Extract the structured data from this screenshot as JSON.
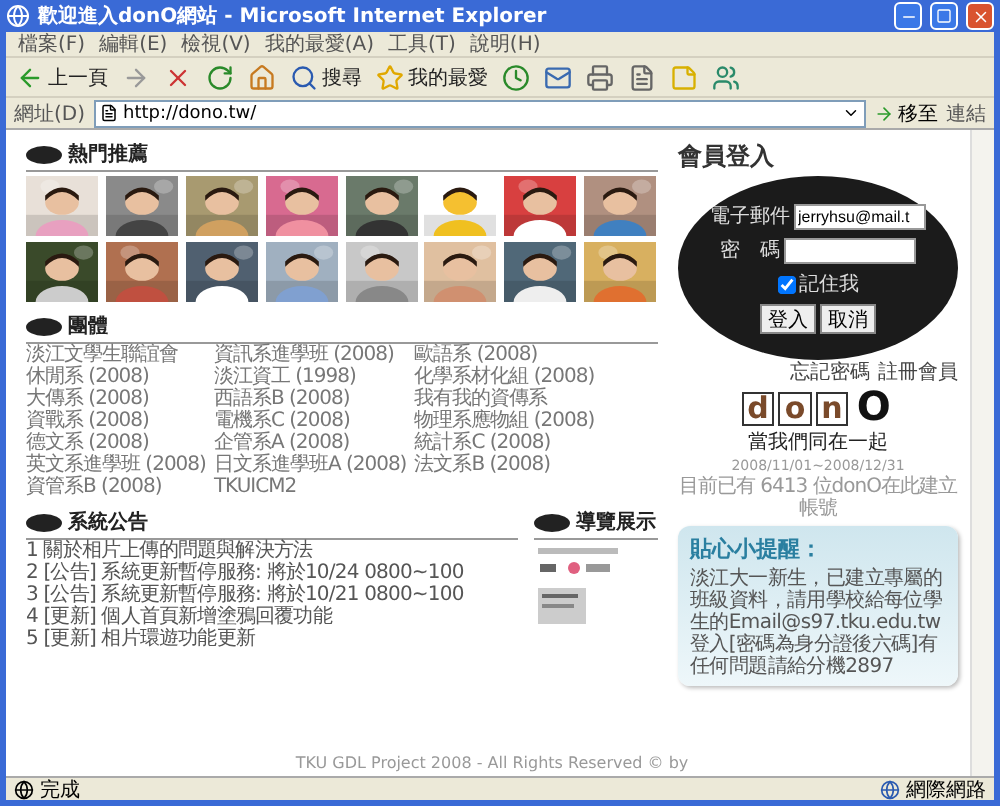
{
  "window": {
    "title": "歡迎進入donO網站 - Microsoft Internet Explorer"
  },
  "menu": [
    "檔案(F)",
    "編輯(E)",
    "檢視(V)",
    "我的最愛(A)",
    "工具(T)",
    "說明(H)"
  ],
  "toolbar": [
    {
      "kind": "back",
      "label": "上一頁"
    },
    {
      "kind": "forward"
    },
    {
      "kind": "stop"
    },
    {
      "kind": "refresh"
    },
    {
      "kind": "home"
    },
    {
      "kind": "search",
      "label": "搜尋"
    },
    {
      "kind": "favorites",
      "label": "我的最愛"
    },
    {
      "kind": "history"
    },
    {
      "kind": "mail"
    },
    {
      "kind": "print"
    },
    {
      "kind": "edit"
    },
    {
      "kind": "note"
    },
    {
      "kind": "messenger"
    }
  ],
  "address": {
    "label": "網址(D)",
    "value": "http://dono.tw/",
    "go": "移至",
    "links": "連結"
  },
  "hot": {
    "title": "熱門推薦"
  },
  "groups": {
    "title": "團體",
    "items": [
      "淡江文學生聯誼會",
      "資訊系進學班 (2008)",
      "歐語系 (2008)",
      "休閒系 (2008)",
      "淡江資工 (1998)",
      "化學系材化組 (2008)",
      "大傳系 (2008)",
      "西語系B (2008)",
      "我有我的資傳系",
      "資戰系 (2008)",
      "電機系C (2008)",
      "物理系應物組 (2008)",
      "德文系 (2008)",
      "企管系A (2008)",
      "統計系C (2008)",
      "英文系進學班 (2008)",
      "日文系進學班A (2008)",
      "法文系B (2008)",
      "資管系B (2008)",
      "TKUICM2"
    ]
  },
  "announcements": {
    "title": "系統公告",
    "items": [
      "1 關於相片上傳的問題與解決方法",
      "2 [公告] 系統更新暫停服務: 將於10/24 0800~100",
      "3 [公告] 系統更新暫停服務: 將於10/21 0800~100",
      "4 [更新] 個人首頁新增塗鴉回覆功能",
      "5 [更新] 相片環遊功能更新"
    ]
  },
  "tour": {
    "title": "導覽展示"
  },
  "login": {
    "title": "會員登入",
    "email_label": "電子郵件",
    "email": "jerryhsu@mail.t",
    "password_label": "密　碼",
    "remember": {
      "label": "記住我",
      "checked": true
    },
    "buttons": [
      "登入",
      "取消"
    ],
    "links": [
      "忘記密碼",
      "註冊會員"
    ]
  },
  "logo": {
    "letters": [
      "d",
      "o",
      "n",
      "O"
    ],
    "slogan": "當我們同在一起",
    "dates": "2008/11/01~2008/12/31"
  },
  "count_text": "目前已有 6413 位donO在此建立帳號",
  "tip": {
    "title": "貼心小提醒：",
    "text": "淡江大一新生，已建立專屬的班級資料，請用學校給每位學生的Email@s97.tku.edu.tw登入[密碼為身分證後六碼]有任何問題請給分機2897"
  },
  "footer": "TKU GDL Project 2008 - All Rights Reserved © by",
  "status": {
    "text": "完成",
    "zone": "網際網路"
  }
}
